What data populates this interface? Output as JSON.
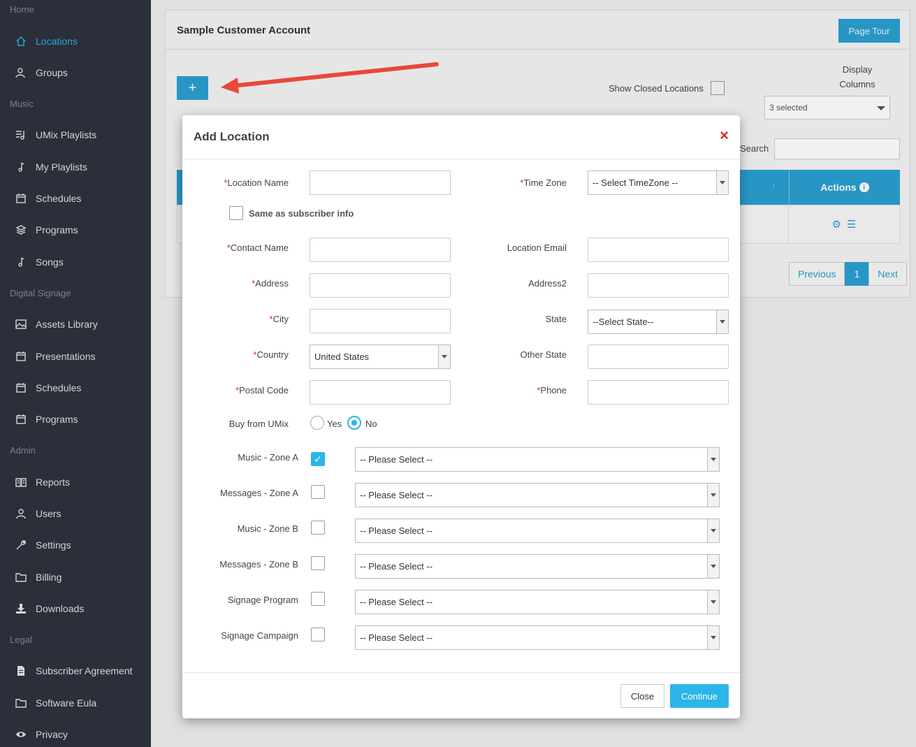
{
  "sidebar": {
    "sections": [
      {
        "title": "Home",
        "items": [
          {
            "label": "Locations",
            "icon": "home-icon"
          },
          {
            "label": "Groups",
            "icon": "users-icon"
          }
        ]
      },
      {
        "title": "Music",
        "items": [
          {
            "label": "UMix Playlists",
            "icon": "playlist-icon"
          },
          {
            "label": "My Playlists",
            "icon": "music-note-icon"
          },
          {
            "label": "Schedules",
            "icon": "calendar-icon"
          },
          {
            "label": "Programs",
            "icon": "layers-icon"
          },
          {
            "label": "Songs",
            "icon": "music-note-icon"
          }
        ]
      },
      {
        "title": "Digital Signage",
        "items": [
          {
            "label": "Assets Library",
            "icon": "image-icon"
          },
          {
            "label": "Presentations",
            "icon": "calendar-icon"
          },
          {
            "label": "Schedules",
            "icon": "calendar-icon"
          },
          {
            "label": "Programs",
            "icon": "calendar-icon"
          }
        ]
      },
      {
        "title": "Admin",
        "items": [
          {
            "label": "Reports",
            "icon": "book-icon"
          },
          {
            "label": "Users",
            "icon": "user-icon"
          },
          {
            "label": "Settings",
            "icon": "wrench-icon"
          },
          {
            "label": "Billing",
            "icon": "folder-icon"
          },
          {
            "label": "Downloads",
            "icon": "download-icon"
          }
        ]
      },
      {
        "title": "Legal",
        "items": [
          {
            "label": "Subscriber Agreement",
            "icon": "document-icon"
          },
          {
            "label": "Software Eula",
            "icon": "folder-icon"
          },
          {
            "label": "Privacy",
            "icon": "eye-icon"
          }
        ]
      }
    ],
    "active_color": "#2fa4d7"
  },
  "page": {
    "title": "Sample Customer Account",
    "page_tour": "Page Tour",
    "add_button": "+",
    "show_closed": "Show Closed Locations",
    "display_columns": "Display Columns",
    "columns_selected": "3 selected",
    "search_label": "Search",
    "actions_header": "Actions",
    "pager": {
      "previous": "Previous",
      "current": "1",
      "next": "Next"
    },
    "accent_color": "#2b9fd1"
  },
  "modal": {
    "title": "Add Location",
    "close_glyph": "×",
    "fields": {
      "location_name": {
        "label": "Location Name",
        "required": true,
        "value": ""
      },
      "time_zone": {
        "label": "Time Zone",
        "required": true,
        "value": "-- Select TimeZone --"
      },
      "same_as_subscriber": {
        "label": "Same as subscriber info",
        "checked": false
      },
      "contact_name": {
        "label": "Contact Name",
        "required": true,
        "value": ""
      },
      "location_email": {
        "label": "Location Email",
        "value": ""
      },
      "address": {
        "label": "Address",
        "required": true,
        "value": ""
      },
      "address2": {
        "label": "Address2",
        "value": ""
      },
      "city": {
        "label": "City",
        "required": true,
        "value": ""
      },
      "state": {
        "label": "State",
        "value": "--Select State--"
      },
      "country": {
        "label": "Country",
        "required": true,
        "value": "United States"
      },
      "other_state": {
        "label": "Other State",
        "value": ""
      },
      "postal_code": {
        "label": "Postal Code",
        "required": true,
        "value": ""
      },
      "phone": {
        "label": "Phone",
        "required": true,
        "value": ""
      },
      "buy_from_umix": {
        "label": "Buy from UMix",
        "yes": "Yes",
        "no": "No",
        "selected": "No"
      }
    },
    "zones": [
      {
        "label": "Music - Zone A",
        "checked": true,
        "value": "-- Please Select --"
      },
      {
        "label": "Messages - Zone A",
        "checked": false,
        "value": "-- Please Select --"
      },
      {
        "label": "Music - Zone B",
        "checked": false,
        "value": "-- Please Select --"
      },
      {
        "label": "Messages - Zone B",
        "checked": false,
        "value": "-- Please Select --"
      },
      {
        "label": "Signage Program",
        "checked": false,
        "value": "-- Please Select --"
      },
      {
        "label": "Signage Campaign",
        "checked": false,
        "value": "-- Please Select --"
      }
    ],
    "close_button": "Close",
    "continue_button": "Continue",
    "required_mark": "*",
    "required_color": "#d9262c",
    "continue_color": "#2bb5e8"
  },
  "annotation": {
    "arrow_color": "#e8483b"
  }
}
